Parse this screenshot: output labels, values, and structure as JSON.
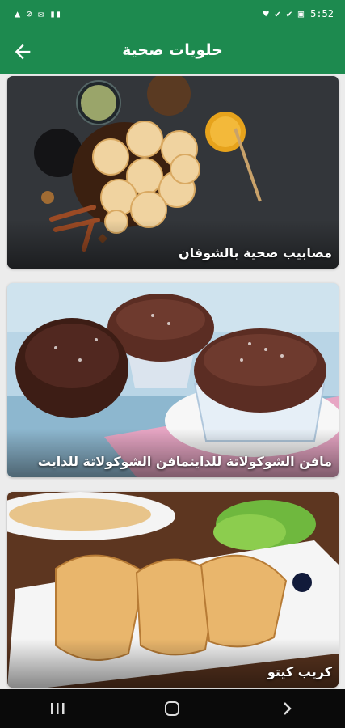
{
  "status_bar": {
    "left": "▲ ⊘ ✉ ▮▮",
    "time": "5:52",
    "right_icons": "♥ ✔ ✔ ▣"
  },
  "app_bar": {
    "title": "حلويات صحية",
    "back_icon": "arrow-left-icon"
  },
  "cards": [
    {
      "label": "مصابيب صحية بالشوفان"
    },
    {
      "label": "مافن الشوكولاتة للدايتمافن الشوكولاتة للدايت"
    },
    {
      "label": "كريب كيتو"
    }
  ],
  "nav": {
    "recent_icon": "recent-apps-icon",
    "home_icon": "home-icon",
    "back_icon": "back-chevron-icon"
  },
  "colors": {
    "primary": "#1d8a4f",
    "background": "#ececec",
    "nav": "#0a0a0a"
  }
}
